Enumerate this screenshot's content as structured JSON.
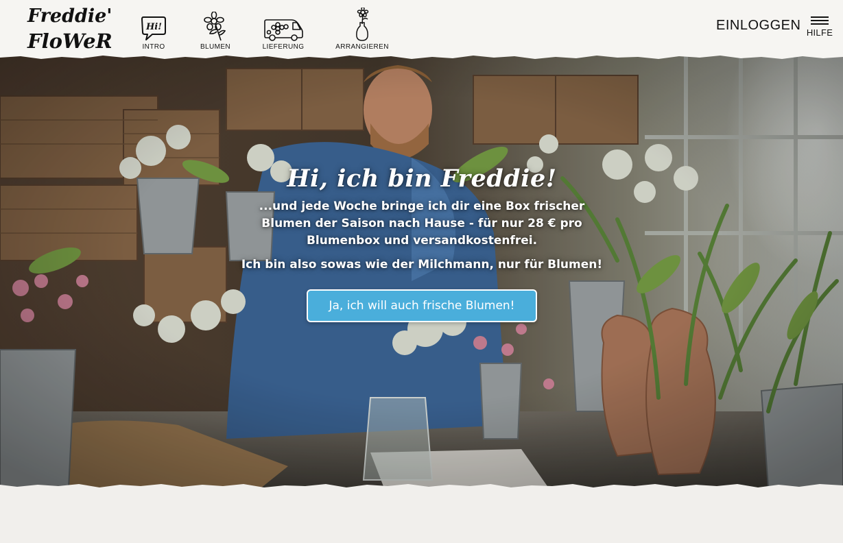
{
  "header": {
    "logo_text_line1": "Freddie's",
    "logo_text_line2": "FloWeRs",
    "nav": [
      {
        "label": "INTRO",
        "icon": "speech-bubble-icon",
        "bubble_text": "Hi!"
      },
      {
        "label": "BLUMEN",
        "icon": "flower-icon"
      },
      {
        "label": "LIEFERUNG",
        "icon": "van-icon"
      },
      {
        "label": "ARRANGIEREN",
        "icon": "vase-icon"
      }
    ],
    "login_label": "EINLOGGEN",
    "help_label": "HILFE"
  },
  "hero": {
    "title": "Hi, ich bin Freddie!",
    "subtitle": "...und jede Woche bringe ich dir eine Box frischer Blumen der Saison nach Hause - für nur 28 € pro Blumenbox und versandkostenfrei.",
    "subtitle2": "Ich bin also sowas wie der Milchmann, nur für Blumen!",
    "cta_label": "Ja, ich will auch frische Blumen!"
  },
  "colors": {
    "accent": "#4aaedb",
    "header_bg": "#f6f5f2",
    "page_bg": "#f1efec"
  }
}
